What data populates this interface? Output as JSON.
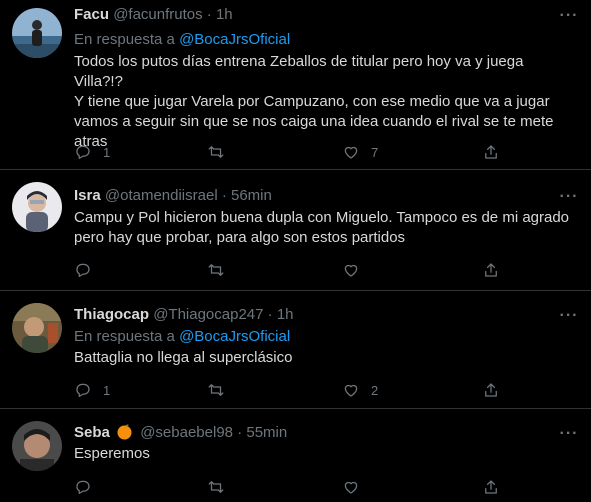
{
  "colors": {
    "background": "#000000",
    "text": "#d9d9d9",
    "muted": "#6e767d",
    "link": "#1d9bf0",
    "divider": "#2f3336"
  },
  "tweets": [
    {
      "name": "Facu",
      "handle": "@facunfrutos",
      "dot": "·",
      "time": "1h",
      "replying_prefix": "En respuesta a ",
      "replying_to": "@BocaJrsOficial",
      "lines": [
        "Todos los putos días entrena Zeballos de titular pero hoy va y juega Villa?!?",
        "Y tiene que jugar Varela por Campuzano, con ese medio que va a jugar",
        "vamos a seguir sin que se nos caiga una idea cuando el rival se te mete",
        "atras"
      ],
      "reply_count": "1",
      "retweet_count": "",
      "like_count": "7"
    },
    {
      "name": "Isra",
      "handle": "@otamendiisrael",
      "dot": "·",
      "time": "56min",
      "lines": [
        "Campu y Pol hicieron buena dupla con Miguelo. Tampoco es de mi agrado",
        "pero hay que probar, para algo son estos partidos"
      ],
      "reply_count": "",
      "retweet_count": "",
      "like_count": ""
    },
    {
      "name": "Thiagocap",
      "handle": "@Thiagocap247",
      "dot": "·",
      "time": "1h",
      "replying_prefix": "En respuesta a ",
      "replying_to": "@BocaJrsOficial",
      "lines": [
        "Battaglia no llega al superclásico"
      ],
      "reply_count": "1",
      "retweet_count": "",
      "like_count": "2"
    },
    {
      "name": "Seba",
      "badge_icon": "orange-emoji-icon",
      "handle": "@sebaebel98",
      "dot": "·",
      "time": "55min",
      "lines": [
        "Esperemos"
      ],
      "reply_count": "",
      "retweet_count": "",
      "like_count": ""
    }
  ],
  "more_symbol": "···"
}
